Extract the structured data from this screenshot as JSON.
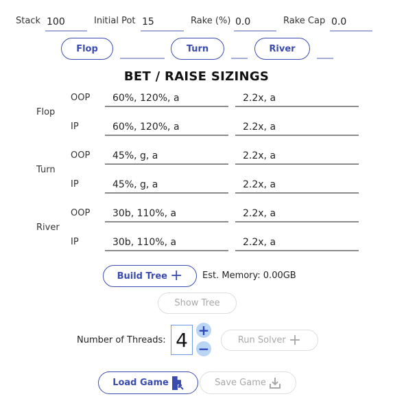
{
  "params": {
    "stack_label": "Stack",
    "stack_value": "100",
    "pot_label": "Initial Pot",
    "pot_value": "15",
    "rake_label": "Rake (%)",
    "rake_value": "0.0",
    "rakecap_label": "Rake Cap",
    "rakecap_value": "0.0"
  },
  "board": {
    "flop_label": "Flop",
    "flop_value": "",
    "turn_label": "Turn",
    "turn_value": "",
    "river_label": "River",
    "river_value": ""
  },
  "sizings": {
    "title": "BET / RAISE SIZINGS",
    "streets": [
      {
        "name": "Flop",
        "rows": [
          {
            "pos": "OOP",
            "bet": "60%, 120%, a",
            "raise": "2.2x, a"
          },
          {
            "pos": "IP",
            "bet": "60%, 120%, a",
            "raise": "2.2x, a"
          }
        ]
      },
      {
        "name": "Turn",
        "rows": [
          {
            "pos": "OOP",
            "bet": "45%, g, a",
            "raise": "2.2x, a"
          },
          {
            "pos": "IP",
            "bet": "45%, g, a",
            "raise": "2.2x, a"
          }
        ]
      },
      {
        "name": "River",
        "rows": [
          {
            "pos": "OOP",
            "bet": "30b, 110%, a",
            "raise": "2.2x, a"
          },
          {
            "pos": "IP",
            "bet": "30b, 110%, a",
            "raise": "2.2x, a"
          }
        ]
      }
    ]
  },
  "tree": {
    "build_label": "Build Tree",
    "memory_text": "Est. Memory: 0.00GB",
    "show_label": "Show Tree"
  },
  "solver": {
    "threads_label": "Number of Threads:",
    "threads_value": "4",
    "plus_symbol": "+",
    "minus_symbol": "−",
    "run_label": "Run Solver"
  },
  "game": {
    "load_label": "Load Game",
    "save_label": "Save Game"
  },
  "colors": {
    "accent": "#3a4bb0",
    "underline": "#a4acd9",
    "disabled": "#a8a8a8",
    "stepper_bg": "#b9d4f5"
  }
}
